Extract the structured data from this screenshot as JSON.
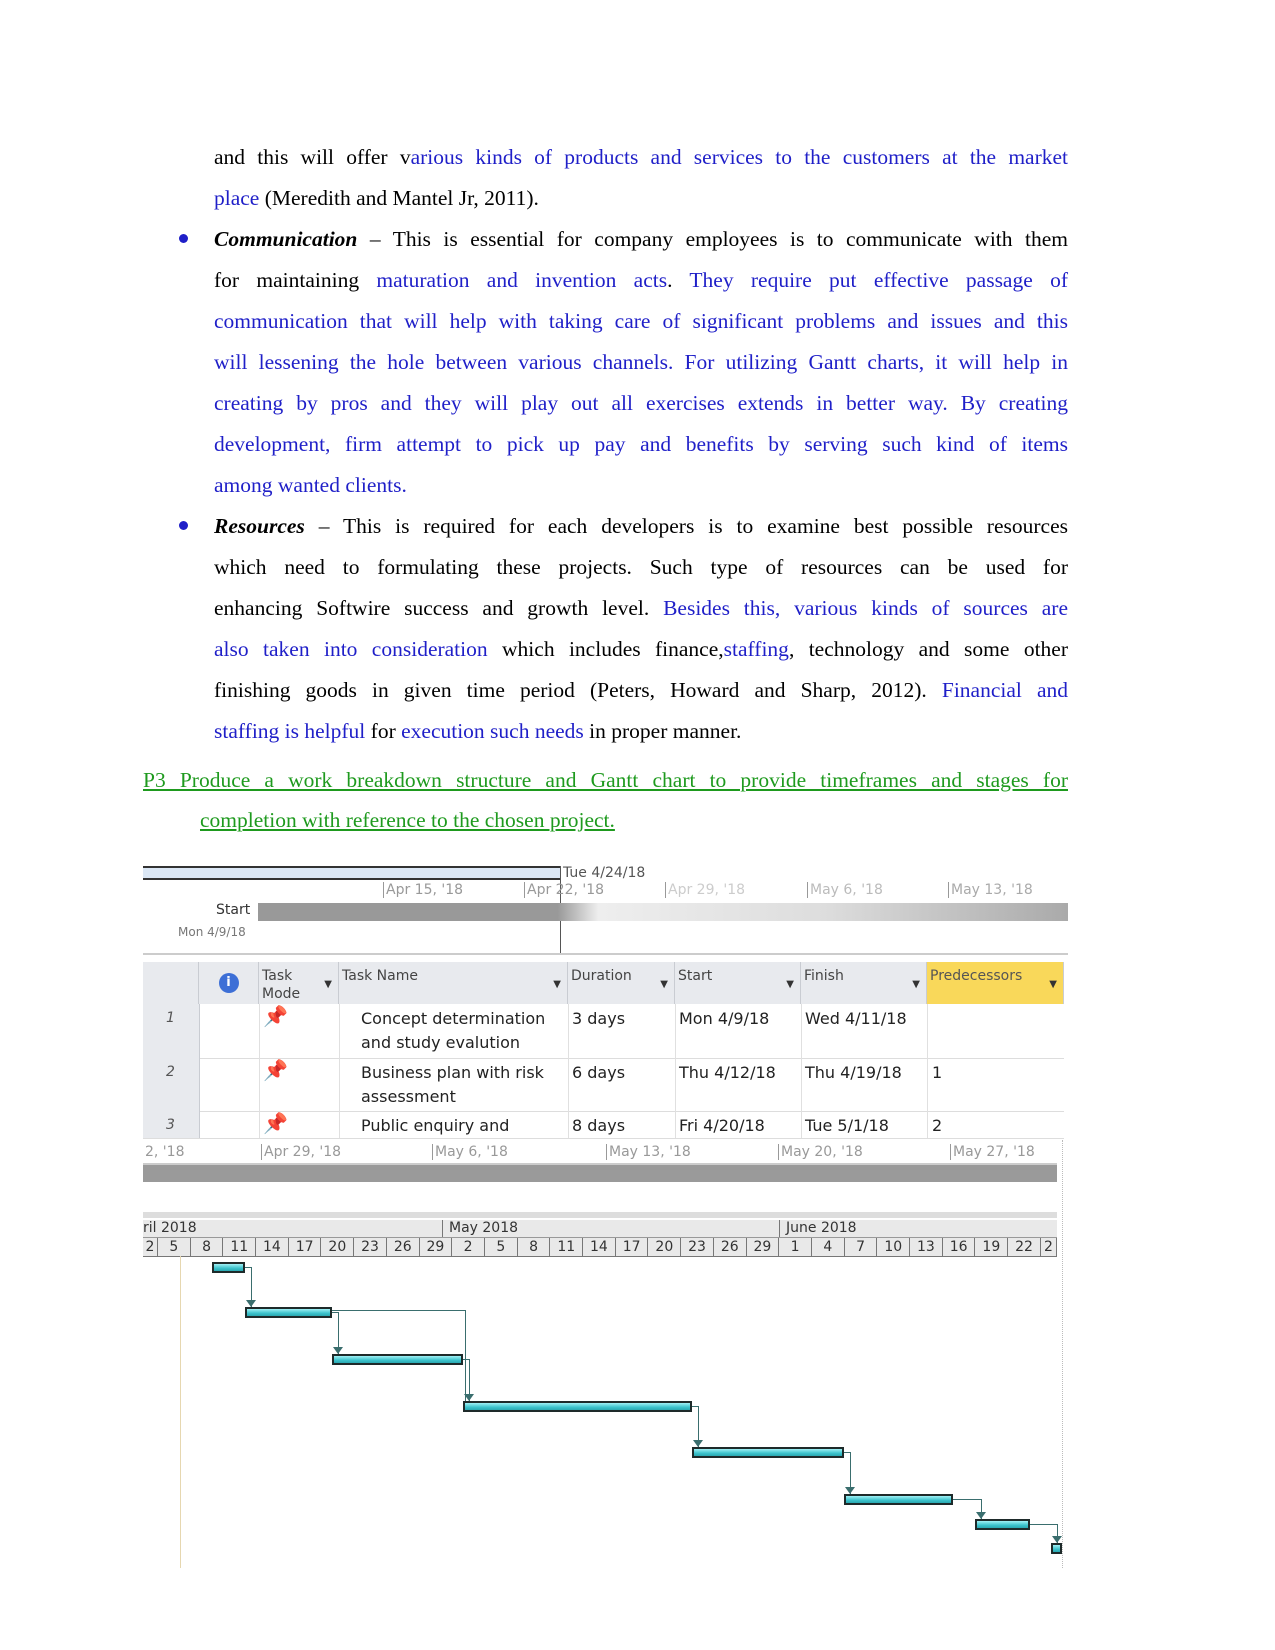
{
  "paragraphs": [
    [
      {
        "t": "and this will offer v",
        "c": "black"
      },
      {
        "t": "arious kinds of products and services to the customers at the market",
        "c": "blue"
      }
    ],
    [
      {
        "t": "place",
        "c": "blue"
      },
      {
        "t": " (Meredith and Mantel Jr, 2011).",
        "c": "black"
      }
    ],
    [
      {
        "t": "Communication",
        "c": "bi"
      },
      {
        "t": " – This is essential for company employees is to communicate with them",
        "c": "black"
      }
    ],
    [
      {
        "t": "for maintaining ",
        "c": "black"
      },
      {
        "t": "maturation and invention acts",
        "c": "blue"
      },
      {
        "t": ". ",
        "c": "black"
      },
      {
        "t": "They require put effective passage of",
        "c": "blue"
      }
    ],
    [
      {
        "t": "communication that will help with taking care of significant problems and issues and this",
        "c": "blue"
      }
    ],
    [
      {
        "t": "will lessening the hole between various channels. For utilizing Gantt charts, it will help in",
        "c": "blue"
      }
    ],
    [
      {
        "t": "creating by pros and they will play out all exercises extends in better way. By creating",
        "c": "blue"
      }
    ],
    [
      {
        "t": "development, firm attempt to pick up pay and benefits by serving such kind of items",
        "c": "blue"
      }
    ],
    [
      {
        "t": "among wanted clients.",
        "c": "blue"
      }
    ],
    [
      {
        "t": "Resources",
        "c": "bi"
      },
      {
        "t": " – This is required for each developers is to examine best possible resources",
        "c": "black"
      }
    ],
    [
      {
        "t": "which need to formulating these projects. Such type of resources can be used for",
        "c": "black"
      }
    ],
    [
      {
        "t": "enhancing Softwire success and growth level. ",
        "c": "black"
      },
      {
        "t": "Besides this, various kinds of sources are",
        "c": "blue"
      }
    ],
    [
      {
        "t": "also taken into consideration",
        "c": "blue"
      },
      {
        "t": " which includes finance,",
        "c": "black"
      },
      {
        "t": "staffing",
        "c": "blue"
      },
      {
        "t": ", technology and some other",
        "c": "black"
      }
    ],
    [
      {
        "t": "finishing goods in given time period (Peters, Howard and Sharp, 2012). ",
        "c": "black"
      },
      {
        "t": "Financial and",
        "c": "blue"
      }
    ],
    [
      {
        "t": "staffing is helpful",
        "c": "blue"
      },
      {
        "t": " for ",
        "c": "black"
      },
      {
        "t": "execution such needs",
        "c": "blue"
      },
      {
        "t": " in proper manner.",
        "c": "black"
      }
    ]
  ],
  "heading": {
    "line1": "P3 Produce a work breakdown structure and Gantt chart to provide timeframes and stages for",
    "line2": "completion with reference to the chosen project."
  },
  "colors": {
    "blue": "#1f1fc8",
    "green": "#1e9a1e",
    "predecessors_header": "#f9d85a",
    "gantt_bar": "#3cc3cc"
  },
  "timeline": {
    "marker": "Tue 4/24/18",
    "start_label": "Start",
    "start_date": "Mon 4/9/18",
    "ticks": [
      "Apr 15, '18",
      "Apr 22, '18",
      "Apr 29, '18",
      "May 6, '18",
      "May 13, '18"
    ]
  },
  "table": {
    "headers": {
      "info": "i",
      "mode": "Task Mode",
      "name": "Task Name",
      "duration": "Duration",
      "start": "Start",
      "finish": "Finish",
      "pred": "Predecessors"
    },
    "rows": [
      {
        "id": "1",
        "name1": "Concept determination",
        "name2": "and study evalution",
        "duration": "3 days",
        "start": "Mon 4/9/18",
        "finish": "Wed 4/11/18",
        "pred": ""
      },
      {
        "id": "2",
        "name1": "Business plan with risk",
        "name2": "assessment",
        "duration": "6 days",
        "start": "Thu 4/12/18",
        "finish": "Thu 4/19/18",
        "pred": "1"
      },
      {
        "id": "3",
        "name1": "Public enquiry and",
        "name2": "",
        "duration": "8 days",
        "start": "Fri 4/20/18",
        "finish": "Tue 5/1/18",
        "pred": "2"
      }
    ]
  },
  "timeline2": {
    "ticks": [
      "2, '18",
      "Apr 29, '18",
      "May 6, '18",
      "May 13, '18",
      "May 20, '18",
      "May 27, '18"
    ]
  },
  "gantt": {
    "months": [
      "ril 2018",
      "May 2018",
      "June 2018"
    ],
    "days": [
      "2",
      "5",
      "8",
      "11",
      "14",
      "17",
      "20",
      "23",
      "26",
      "29",
      "2",
      "5",
      "8",
      "11",
      "14",
      "17",
      "20",
      "23",
      "26",
      "29",
      "1",
      "4",
      "7",
      "10",
      "13",
      "16",
      "19",
      "22",
      "2"
    ],
    "bars": [
      {
        "start": "2018-04-08",
        "finish": "2018-04-11"
      },
      {
        "start": "2018-04-11",
        "finish": "2018-04-19"
      },
      {
        "start": "2018-04-19",
        "finish": "2018-05-01"
      },
      {
        "start": "2018-05-01",
        "finish": "2018-05-22"
      },
      {
        "start": "2018-05-22",
        "finish": "2018-06-05"
      },
      {
        "start": "2018-06-05",
        "finish": "2018-06-15"
      },
      {
        "start": "2018-06-17",
        "finish": "2018-06-22"
      },
      {
        "start": "2018-06-24",
        "finish": "2018-06-25"
      }
    ]
  }
}
